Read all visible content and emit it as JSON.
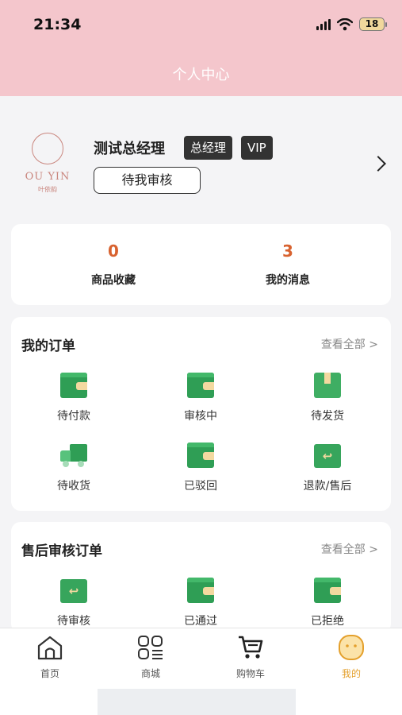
{
  "status_bar": {
    "time": "21:34",
    "battery": "18"
  },
  "header": {
    "title": "个人中心"
  },
  "profile": {
    "logo_text": "OU YIN",
    "logo_sub": "叶依韵",
    "name": "测试总经理",
    "role_tag": "总经理",
    "vip_tag": "VIP",
    "review_button": "待我审核"
  },
  "stats": [
    {
      "value": "0",
      "label": "商品收藏"
    },
    {
      "value": "3",
      "label": "我的消息"
    }
  ],
  "orders": {
    "title": "我的订单",
    "view_all": "查看全部 >",
    "items": [
      {
        "label": "待付款",
        "icon": "wallet-icon"
      },
      {
        "label": "审核中",
        "icon": "wallet-icon"
      },
      {
        "label": "待发货",
        "icon": "gift-box-icon"
      },
      {
        "label": "待收货",
        "icon": "truck-icon"
      },
      {
        "label": "已驳回",
        "icon": "wallet-icon"
      },
      {
        "label": "退款/售后",
        "icon": "return-box-icon"
      }
    ]
  },
  "after_sales": {
    "title": "售后审核订单",
    "view_all": "查看全部 >",
    "items": [
      {
        "label": "待审核",
        "icon": "return-box-icon"
      },
      {
        "label": "已通过",
        "icon": "wallet-icon"
      },
      {
        "label": "已拒绝",
        "icon": "wallet-icon"
      }
    ]
  },
  "tabbar": [
    {
      "label": "首页",
      "icon": "home-icon"
    },
    {
      "label": "商城",
      "icon": "grid-icon"
    },
    {
      "label": "购物车",
      "icon": "cart-icon"
    },
    {
      "label": "我的",
      "icon": "face-icon",
      "active": true
    }
  ],
  "colors": {
    "header_bg": "#f4c6cc",
    "accent_orange": "#d8622f",
    "tab_active": "#e4a02c",
    "icon_green": "#2f9e55"
  }
}
